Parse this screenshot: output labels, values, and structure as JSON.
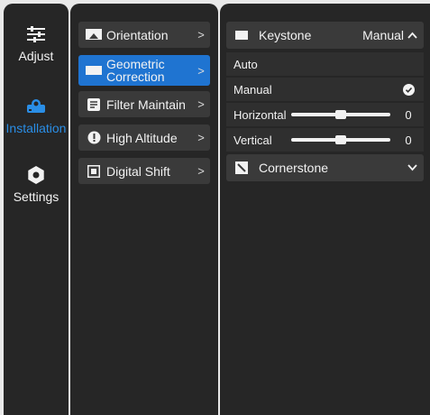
{
  "nav": {
    "items": [
      {
        "label": "Adjust",
        "icon": "sliders-icon"
      },
      {
        "label": "Installation",
        "icon": "projector-icon",
        "active": true
      },
      {
        "label": "Settings",
        "icon": "gear-icon"
      }
    ]
  },
  "menu": {
    "items": [
      {
        "label": "Orientation",
        "icon": "orientation-icon"
      },
      {
        "label": "Geometric Correction",
        "icon": "screen-icon",
        "active": true
      },
      {
        "label": "Filter Maintain",
        "icon": "filter-icon"
      },
      {
        "label": "High Altitude",
        "icon": "altitude-icon"
      },
      {
        "label": "Digital Shift",
        "icon": "digital-shift-icon"
      }
    ],
    "chevron": ">"
  },
  "detail": {
    "keystone": {
      "title": "Keystone",
      "value": "Manual",
      "chevron": "^"
    },
    "options": [
      {
        "label": "Auto",
        "selected": false
      },
      {
        "label": "Manual",
        "selected": true
      }
    ],
    "sliders": [
      {
        "label": "Horizontal",
        "value": "0",
        "level": 0.5
      },
      {
        "label": "Vertical",
        "value": "0",
        "level": 0.5
      }
    ],
    "cornerstone": {
      "title": "Cornerstone",
      "chevron": "v"
    }
  },
  "colors": {
    "accent": "#1f74d1",
    "nav_active": "#2a8ee6",
    "panel": "#262626",
    "item": "#3a3a3a"
  }
}
